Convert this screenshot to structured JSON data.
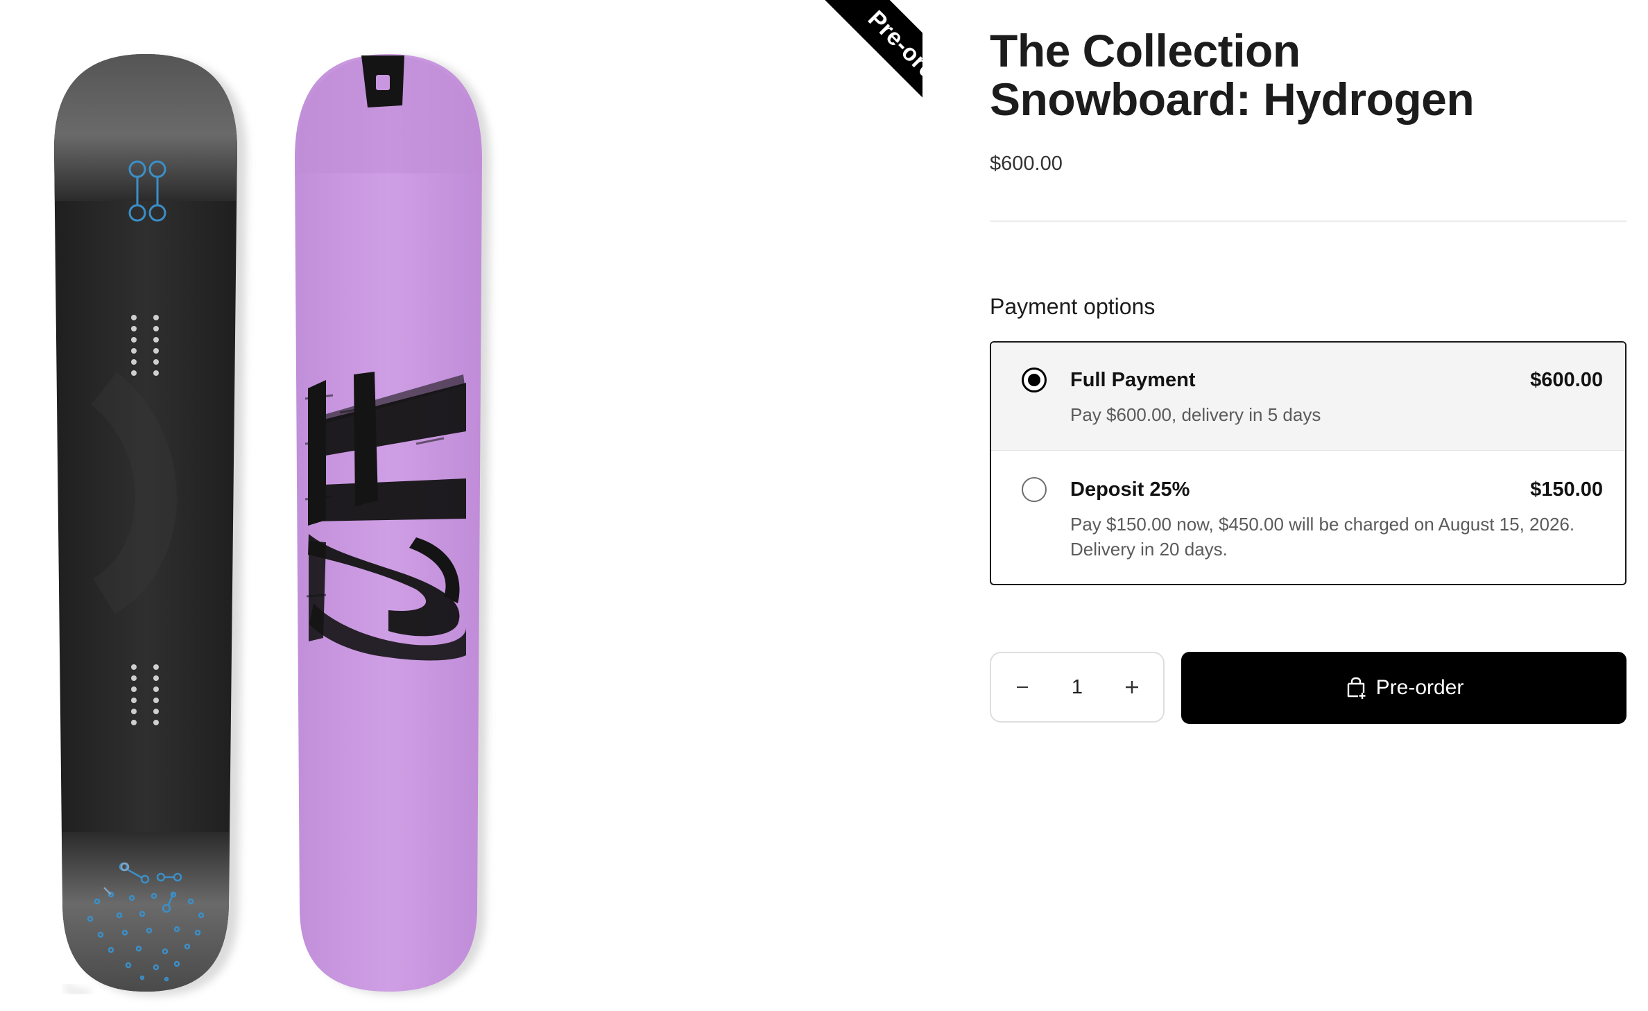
{
  "gallery": {
    "badge": "Pre-order",
    "board_front": {
      "name": "hydrogen-snowboard-top",
      "base_color": "#2b2b2b",
      "accent_color": "#3b8fc8"
    },
    "board_back": {
      "name": "hydrogen-snowboard-base",
      "base_color": "#c997e0",
      "accent_color": "#141414"
    }
  },
  "product": {
    "title_line1": "The Collection",
    "title_line2": "Snowboard: Hydrogen",
    "price": "$600.00"
  },
  "payment": {
    "heading": "Payment options",
    "options": [
      {
        "name": "Full Payment",
        "price": "$600.00",
        "desc": "Pay $600.00, delivery in 5 days",
        "selected": true
      },
      {
        "name": "Deposit 25%",
        "price": "$150.00",
        "desc": "Pay $150.00 now, $450.00 will be charged on August 15, 2026. Delivery in 20 days.",
        "selected": false
      }
    ]
  },
  "quantity": {
    "value": "1",
    "minus_icon": "minus-icon",
    "plus_icon": "plus-icon"
  },
  "cta": {
    "label": "Pre-order",
    "icon": "bag-plus-icon"
  },
  "colors": {
    "accent": "#000000",
    "text": "#121212",
    "muted": "#5b5b5b",
    "selected_bg": "#f4f4f4"
  }
}
